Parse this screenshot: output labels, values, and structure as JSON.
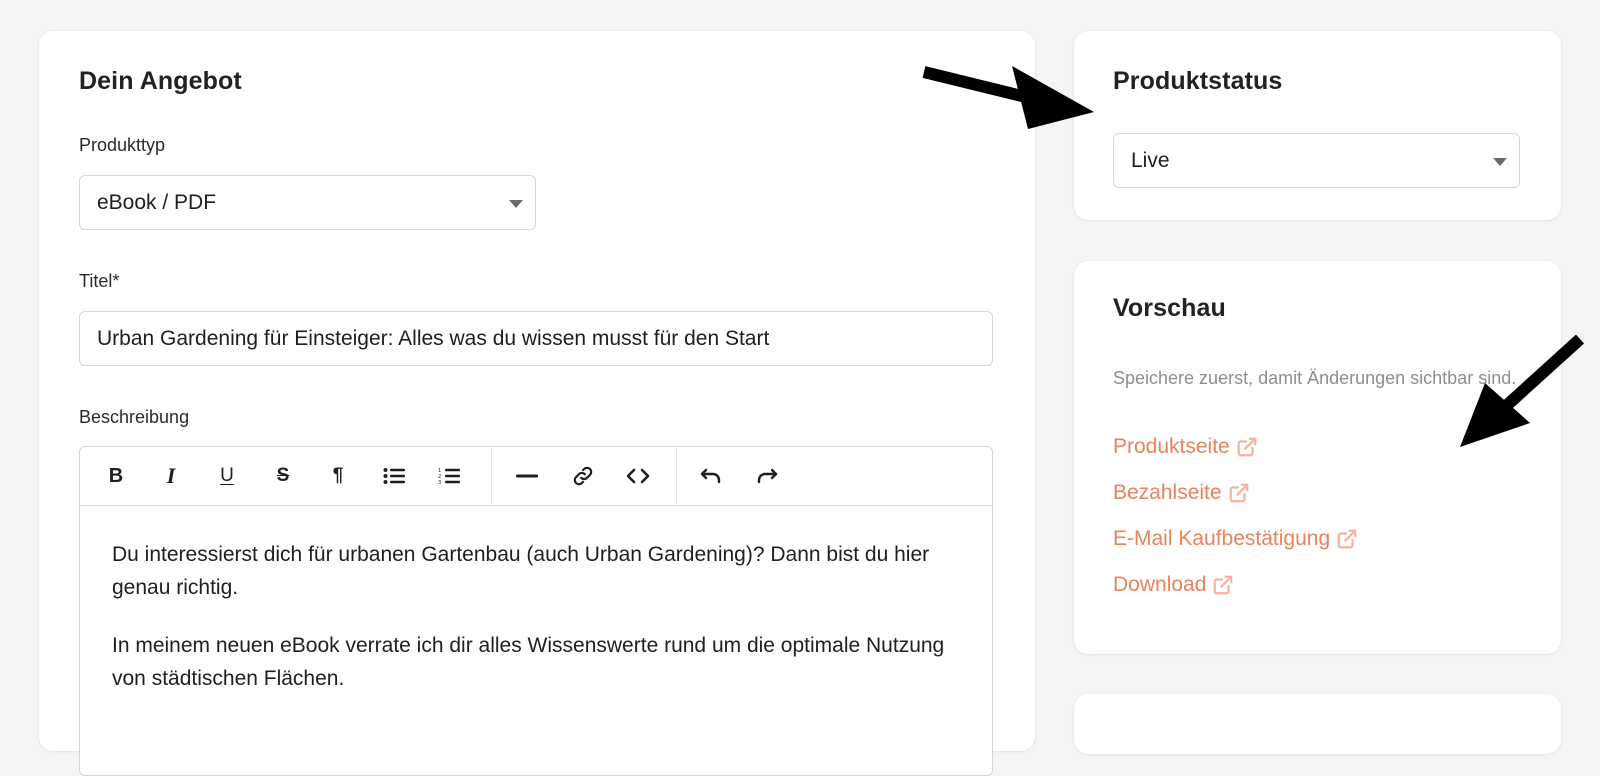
{
  "offer": {
    "title": "Dein Angebot",
    "product_type": {
      "label": "Produkttyp",
      "value": "eBook / PDF"
    },
    "title_field": {
      "label": "Titel*",
      "value": "Urban Gardening für Einsteiger: Alles was du wissen musst für den Start"
    },
    "description": {
      "label": "Beschreibung",
      "toolbar": [
        "bold-icon",
        "italic-icon",
        "underline-icon",
        "strikethrough-icon",
        "paragraph-icon",
        "bullet-list-icon",
        "ordered-list-icon",
        "horizontal-rule-icon",
        "link-icon",
        "code-icon",
        "undo-icon",
        "redo-icon"
      ],
      "paragraphs": [
        "Du interessierst dich für urbanen Gartenbau (auch Urban Gardening)? Dann bist du hier genau richtig.",
        "In meinem neuen eBook verrate ich dir alles Wissenswerte rund um die optimale Nutzung von städtischen Flächen."
      ]
    }
  },
  "status": {
    "title": "Produktstatus",
    "value": "Live"
  },
  "preview": {
    "title": "Vorschau",
    "hint": "Speichere zuerst, damit Änderungen sichtbar sind.",
    "links": [
      {
        "label": "Produktseite",
        "icon": "external-link-icon"
      },
      {
        "label": "Bezahlseite",
        "icon": "external-link-icon"
      },
      {
        "label": "E-Mail Kaufbestätigung",
        "icon": "external-link-icon"
      },
      {
        "label": "Download",
        "icon": "external-link-icon"
      }
    ]
  },
  "colors": {
    "background": "#f5f5f5",
    "card": "#ffffff",
    "link": "#e9825e",
    "link_icon": "#f2b4a0",
    "hint": "#8e8e8e",
    "arrow": "#000000"
  }
}
